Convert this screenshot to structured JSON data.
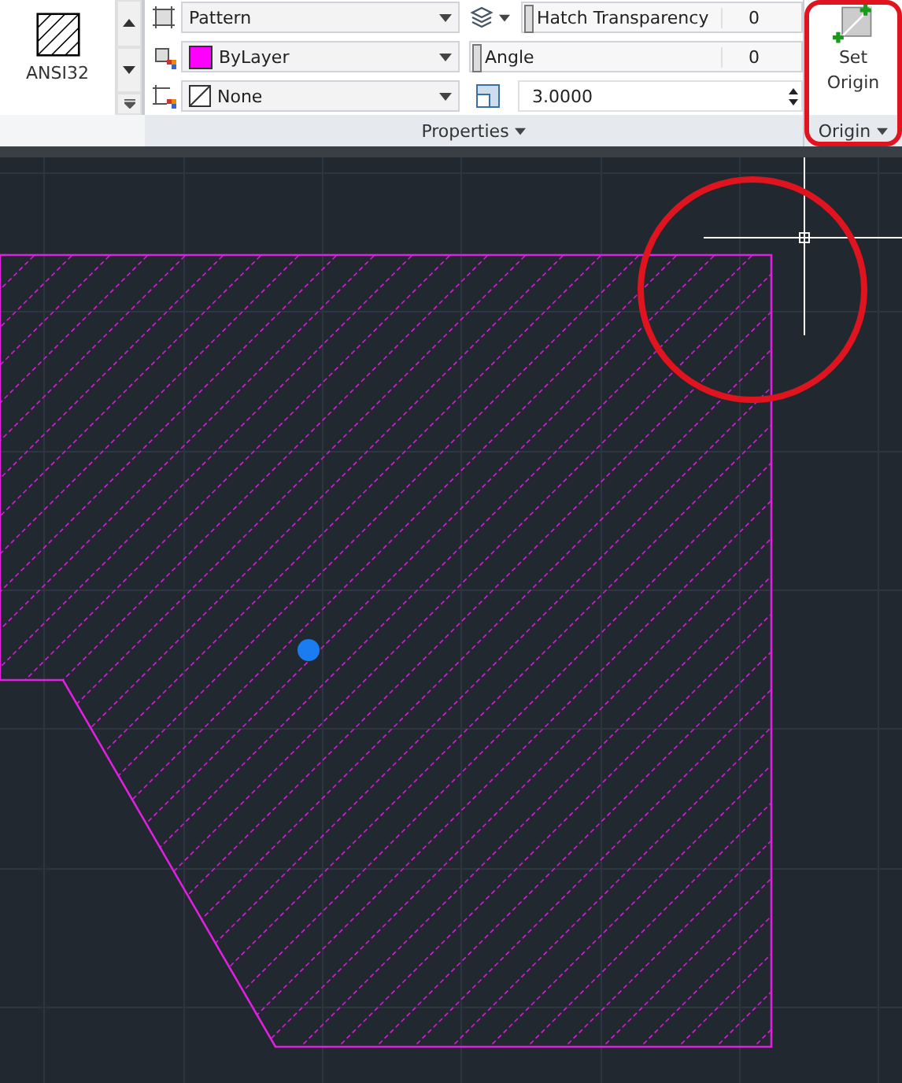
{
  "pattern_gallery": {
    "name": "ANSI32"
  },
  "properties": {
    "type": "Pattern",
    "color": {
      "label": "ByLayer",
      "color": "#ff00ff"
    },
    "background": "None",
    "transparency": {
      "label": "Hatch Transparency",
      "value": "0",
      "level": 0
    },
    "angle": {
      "label": "Angle",
      "value": "0",
      "level": 0
    },
    "scale": "3.0000",
    "title": "Properties"
  },
  "origin": {
    "button": "Set Origin",
    "title": "Origin"
  }
}
